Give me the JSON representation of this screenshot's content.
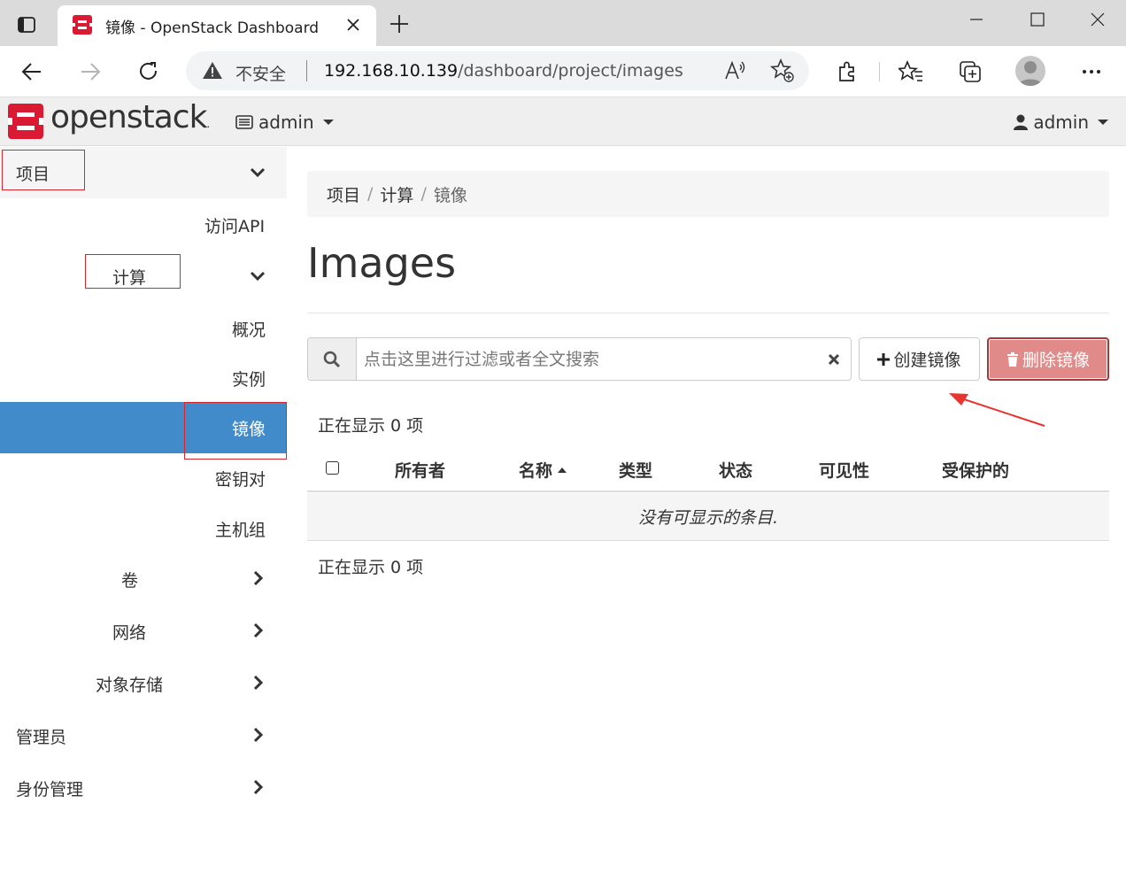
{
  "browser": {
    "tab_title": "镜像 - OpenStack Dashboard",
    "security_label": "不安全",
    "url_host": "192.168.10.139",
    "url_path": "/dashboard/project/images"
  },
  "header": {
    "brand": "openstack",
    "project_selector": "admin",
    "user_menu": "admin"
  },
  "sidebar": {
    "project": "项目",
    "access_api": "访问API",
    "compute": "计算",
    "overview": "概况",
    "instances": "实例",
    "images": "镜像",
    "key_pairs": "密钥对",
    "server_groups": "主机组",
    "volumes": "卷",
    "network": "网络",
    "object_store": "对象存储",
    "admin": "管理员",
    "identity": "身份管理"
  },
  "breadcrumb": [
    "项目",
    "计算",
    "镜像"
  ],
  "page": {
    "title": "Images",
    "search_placeholder": "点击这里进行过滤或者全文搜索",
    "create_button": "创建镜像",
    "delete_button": "删除镜像",
    "count_top": "正在显示 0 项",
    "count_bottom": "正在显示 0 项",
    "empty_message": "没有可显示的条目."
  },
  "table": {
    "columns": [
      "所有者",
      "名称",
      "类型",
      "状态",
      "可见性",
      "受保护的"
    ],
    "sorted_column": "名称"
  },
  "colors": {
    "active_nav": "#428bca",
    "delete_button": "#e08b89",
    "brand_red": "#da1a32",
    "annotation_red": "#d9252d"
  }
}
